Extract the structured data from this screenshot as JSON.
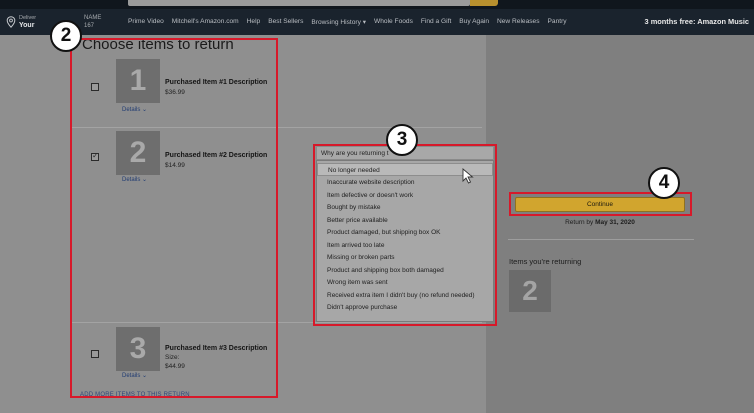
{
  "nav": {
    "deliver_line1": "Deliver",
    "deliver_line2": "Your",
    "account_line1": "NAME",
    "account_line2": "167",
    "links": [
      "Prime Video",
      "Mitchell's Amazon.com",
      "Help",
      "Best Sellers",
      "Browsing History ▾",
      "Whole Foods",
      "Find a Gift",
      "Buy Again",
      "New Releases",
      "Pantry"
    ],
    "promo": "3 months free: Amazon Music"
  },
  "main": {
    "heading": "Choose items to return",
    "items": [
      {
        "thumb": "1",
        "details": "Details ⌄",
        "name": "Purchased Item #1 Description",
        "size": "",
        "price": "$36.99",
        "checked": false
      },
      {
        "thumb": "2",
        "details": "Details ⌄",
        "name": "Purchased Item #2 Description",
        "size": "",
        "price": "$14.99",
        "checked": true
      },
      {
        "thumb": "3",
        "details": "Details ⌄",
        "name": "Purchased Item #3 Description",
        "size": "Size:",
        "price": "$44.99",
        "checked": false
      }
    ],
    "add_more": "ADD MORE ITEMS TO THIS RETURN"
  },
  "reason": {
    "label": "Why are you returning t",
    "options": [
      "No longer needed",
      "Inaccurate website description",
      "Item defective or doesn't work",
      "Bought by mistake",
      "Better price available",
      "Product damaged, but shipping box OK",
      "Item arrived too late",
      "Missing or broken parts",
      "Product and shipping box both damaged",
      "Wrong item was sent",
      "Received extra item I didn't buy (no refund needed)",
      "Didn't approve purchase"
    ],
    "highlighted_index": 0
  },
  "summary": {
    "continue_label": "Continue",
    "return_by_prefix": "Return by",
    "return_by_date": "May 31, 2020",
    "returning_label": "Items you're returning",
    "returning_thumb": "2"
  },
  "annotations": {
    "badge_2": "2",
    "badge_3": "3",
    "badge_4": "4",
    "box_color": "#d7192a"
  }
}
